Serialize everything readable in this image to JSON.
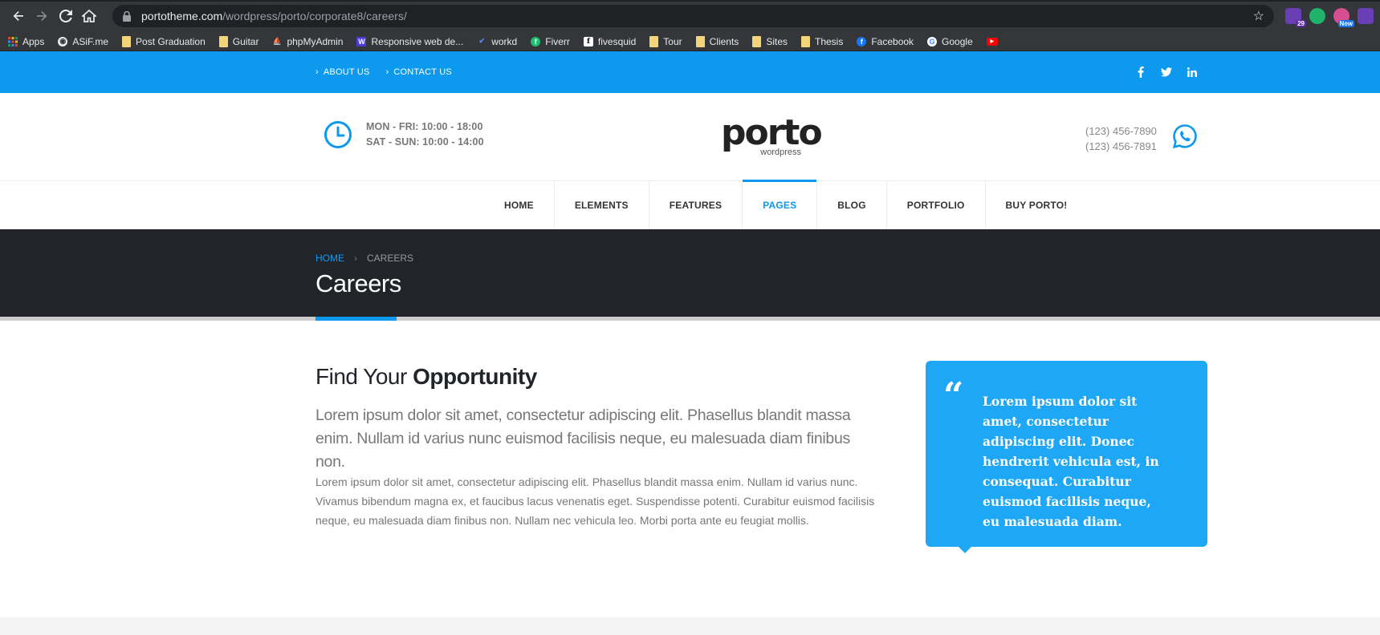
{
  "browser": {
    "url_host": "portotheme.com",
    "url_path": "/wordpress/porto/corporate8/careers/",
    "extensions": [
      {
        "name": "ext-1",
        "badge": "29",
        "color": "#6a3fb5"
      },
      {
        "name": "ext-2",
        "badge": "",
        "color": "#1fb36b"
      },
      {
        "name": "ext-3",
        "badge": "New",
        "color": "#d84d8d"
      },
      {
        "name": "ext-4",
        "badge": "",
        "color": "#6a3fb5"
      }
    ]
  },
  "bookmarks": [
    {
      "label": "Apps",
      "icon": "apps-grid-icon"
    },
    {
      "label": "ASiF.me",
      "icon": "globe-icon"
    },
    {
      "label": "Post Graduation",
      "icon": "folder-icon"
    },
    {
      "label": "Guitar",
      "icon": "folder-icon"
    },
    {
      "label": "phpMyAdmin",
      "icon": "phpmyadmin-icon"
    },
    {
      "label": "Responsive web de...",
      "icon": "w-icon"
    },
    {
      "label": "workd",
      "icon": "workd-icon"
    },
    {
      "label": "Fiverr",
      "icon": "fiverr-icon"
    },
    {
      "label": "fivesquid",
      "icon": "f-icon"
    },
    {
      "label": "Tour",
      "icon": "folder-icon"
    },
    {
      "label": "Clients",
      "icon": "folder-icon"
    },
    {
      "label": "Sites",
      "icon": "folder-icon"
    },
    {
      "label": "Thesis",
      "icon": "folder-icon"
    },
    {
      "label": "Facebook",
      "icon": "facebook-icon"
    },
    {
      "label": "Google",
      "icon": "google-icon"
    },
    {
      "label": "",
      "icon": "youtube-icon"
    }
  ],
  "topbar": {
    "links": [
      "ABOUT US",
      "CONTACT US"
    ],
    "social": [
      "facebook-icon",
      "twitter-icon",
      "linkedin-icon"
    ]
  },
  "header": {
    "hours_line1": "MON - FRI: 10:00 - 18:00",
    "hours_line2": "SAT - SUN: 10:00 - 14:00",
    "logo_main": "porto",
    "logo_sub": "wordpress",
    "phone1": "(123) 456-7890",
    "phone2": "(123) 456-7891"
  },
  "nav": {
    "items": [
      "HOME",
      "ELEMENTS",
      "FEATURES",
      "PAGES",
      "BLOG",
      "PORTFOLIO",
      "BUY PORTO!"
    ],
    "active": "PAGES"
  },
  "page_header": {
    "breadcrumb_home": "HOME",
    "breadcrumb_sep": "›",
    "breadcrumb_current": "CAREERS",
    "title": "Careers"
  },
  "content": {
    "heading_light": "Find Your ",
    "heading_bold": "Opportunity",
    "lead": "Lorem ipsum dolor sit amet, consectetur adipiscing elit. Phasellus blandit massa enim. Nullam id varius nunc euismod facilisis neque, eu malesuada diam finibus non.",
    "para": "Lorem ipsum dolor sit amet, consectetur adipiscing elit. Phasellus blandit massa enim. Nullam id varius nunc. Vivamus bibendum magna ex, et faucibus lacus venenatis eget. Suspendisse potenti. Curabitur euismod facilisis neque, eu malesuada diam finibus non. Nullam nec vehicula leo. Morbi porta ante eu feugiat mollis.",
    "quote_mark": "“",
    "quote": "Lorem ipsum dolor sit amet, consectetur adipiscing elit. Donec hendrerit vehicula est, in consequat. Curabitur euismod facilisis neque, eu malesuada diam."
  },
  "colors": {
    "primary": "#0c99ee",
    "dark": "#212529",
    "quote_bg": "#1ea7f5"
  }
}
